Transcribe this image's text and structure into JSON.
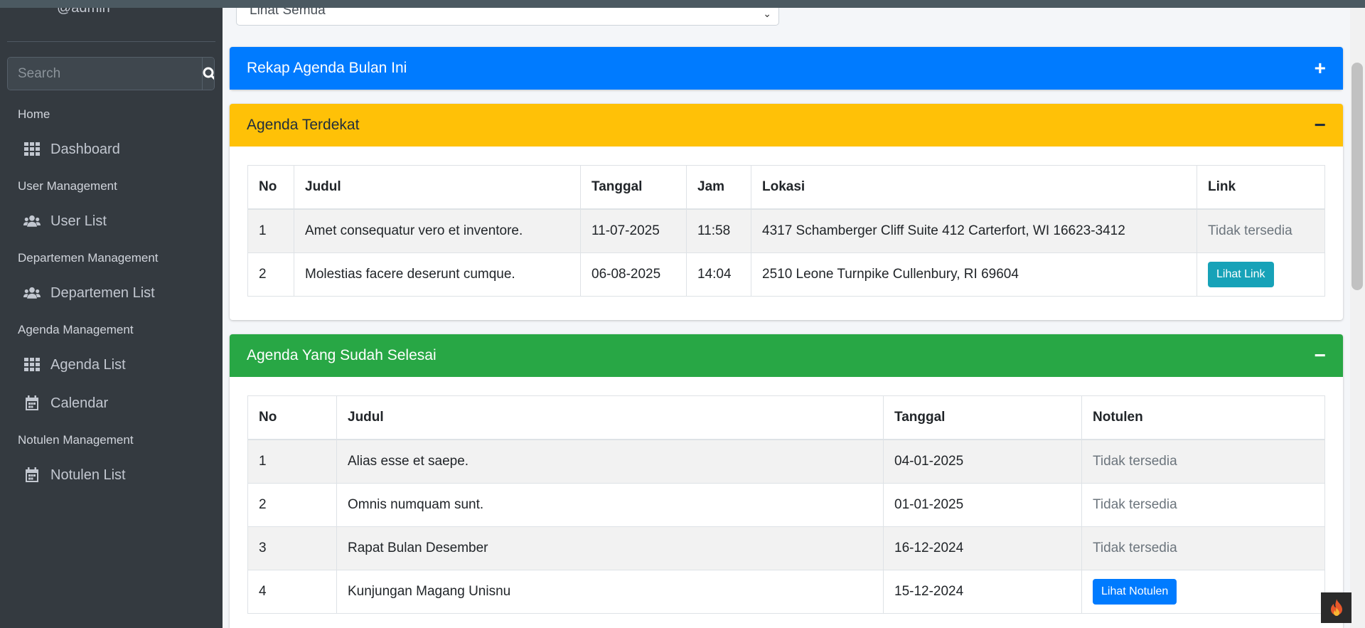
{
  "sidebar": {
    "user": "@admin",
    "search_placeholder": "Search",
    "sections": [
      {
        "header": "Home",
        "items": [
          {
            "label": "Dashboard",
            "icon": "grid-icon"
          }
        ]
      },
      {
        "header": "User Management",
        "items": [
          {
            "label": "User List",
            "icon": "users-icon"
          }
        ]
      },
      {
        "header": "Departemen Management",
        "items": [
          {
            "label": "Departemen List",
            "icon": "users-icon"
          }
        ]
      },
      {
        "header": "Agenda Management",
        "items": [
          {
            "label": "Agenda List",
            "icon": "grid-icon"
          },
          {
            "label": "Calendar",
            "icon": "calendar-icon"
          }
        ]
      },
      {
        "header": "Notulen Management",
        "items": [
          {
            "label": "Notulen List",
            "icon": "calendar-icon"
          }
        ]
      }
    ]
  },
  "filter": {
    "selected": "Lihat Semua"
  },
  "cards": {
    "rekap": {
      "title": "Rekap Agenda Bulan Ini",
      "tool": "+"
    },
    "terdekat": {
      "title": "Agenda Terdekat",
      "tool": "−",
      "columns": [
        "No",
        "Judul",
        "Tanggal",
        "Jam",
        "Lokasi",
        "Link"
      ],
      "rows": [
        {
          "no": "1",
          "judul": "Amet consequatur vero et inventore.",
          "tanggal": "11-07-2025",
          "jam": "11:58",
          "lokasi": "4317 Schamberger Cliff Suite 412 Carterfort, WI 16623-3412",
          "link": "Tidak tersedia"
        },
        {
          "no": "2",
          "judul": "Molestias facere deserunt cumque.",
          "tanggal": "06-08-2025",
          "jam": "14:04",
          "lokasi": "2510 Leone Turnpike Cullenbury, RI 69604",
          "link": "Lihat Link"
        }
      ]
    },
    "selesai": {
      "title": "Agenda Yang Sudah Selesai",
      "tool": "−",
      "columns": [
        "No",
        "Judul",
        "Tanggal",
        "Notulen"
      ],
      "rows": [
        {
          "no": "1",
          "judul": "Alias esse et saepe.",
          "tanggal": "04-01-2025",
          "notulen": "Tidak tersedia"
        },
        {
          "no": "2",
          "judul": "Omnis numquam sunt.",
          "tanggal": "01-01-2025",
          "notulen": "Tidak tersedia"
        },
        {
          "no": "3",
          "judul": "Rapat Bulan Desember",
          "tanggal": "16-12-2024",
          "notulen": "Tidak tersedia"
        },
        {
          "no": "4",
          "judul": "Kunjungan Magang Unisnu",
          "tanggal": "15-12-2024",
          "notulen": "Lihat Notulen"
        }
      ]
    }
  },
  "colors": {
    "primary": "#007bff",
    "warning": "#ffc107",
    "success": "#28a745",
    "info": "#17a2b8",
    "sidebar": "#343a40"
  }
}
